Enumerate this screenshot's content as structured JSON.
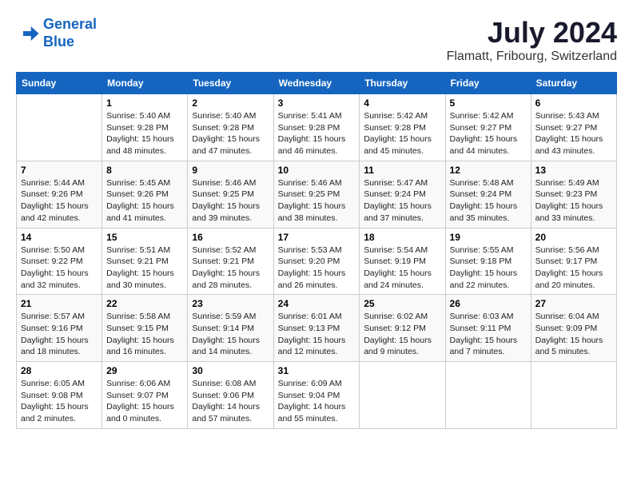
{
  "logo": {
    "line1": "General",
    "line2": "Blue"
  },
  "title": "July 2024",
  "location": "Flamatt, Fribourg, Switzerland",
  "days_of_week": [
    "Sunday",
    "Monday",
    "Tuesday",
    "Wednesday",
    "Thursday",
    "Friday",
    "Saturday"
  ],
  "weeks": [
    [
      {
        "day": "",
        "sunrise": "",
        "sunset": "",
        "daylight": ""
      },
      {
        "day": "1",
        "sunrise": "Sunrise: 5:40 AM",
        "sunset": "Sunset: 9:28 PM",
        "daylight": "Daylight: 15 hours and 48 minutes."
      },
      {
        "day": "2",
        "sunrise": "Sunrise: 5:40 AM",
        "sunset": "Sunset: 9:28 PM",
        "daylight": "Daylight: 15 hours and 47 minutes."
      },
      {
        "day": "3",
        "sunrise": "Sunrise: 5:41 AM",
        "sunset": "Sunset: 9:28 PM",
        "daylight": "Daylight: 15 hours and 46 minutes."
      },
      {
        "day": "4",
        "sunrise": "Sunrise: 5:42 AM",
        "sunset": "Sunset: 9:28 PM",
        "daylight": "Daylight: 15 hours and 45 minutes."
      },
      {
        "day": "5",
        "sunrise": "Sunrise: 5:42 AM",
        "sunset": "Sunset: 9:27 PM",
        "daylight": "Daylight: 15 hours and 44 minutes."
      },
      {
        "day": "6",
        "sunrise": "Sunrise: 5:43 AM",
        "sunset": "Sunset: 9:27 PM",
        "daylight": "Daylight: 15 hours and 43 minutes."
      }
    ],
    [
      {
        "day": "7",
        "sunrise": "Sunrise: 5:44 AM",
        "sunset": "Sunset: 9:26 PM",
        "daylight": "Daylight: 15 hours and 42 minutes."
      },
      {
        "day": "8",
        "sunrise": "Sunrise: 5:45 AM",
        "sunset": "Sunset: 9:26 PM",
        "daylight": "Daylight: 15 hours and 41 minutes."
      },
      {
        "day": "9",
        "sunrise": "Sunrise: 5:46 AM",
        "sunset": "Sunset: 9:25 PM",
        "daylight": "Daylight: 15 hours and 39 minutes."
      },
      {
        "day": "10",
        "sunrise": "Sunrise: 5:46 AM",
        "sunset": "Sunset: 9:25 PM",
        "daylight": "Daylight: 15 hours and 38 minutes."
      },
      {
        "day": "11",
        "sunrise": "Sunrise: 5:47 AM",
        "sunset": "Sunset: 9:24 PM",
        "daylight": "Daylight: 15 hours and 37 minutes."
      },
      {
        "day": "12",
        "sunrise": "Sunrise: 5:48 AM",
        "sunset": "Sunset: 9:24 PM",
        "daylight": "Daylight: 15 hours and 35 minutes."
      },
      {
        "day": "13",
        "sunrise": "Sunrise: 5:49 AM",
        "sunset": "Sunset: 9:23 PM",
        "daylight": "Daylight: 15 hours and 33 minutes."
      }
    ],
    [
      {
        "day": "14",
        "sunrise": "Sunrise: 5:50 AM",
        "sunset": "Sunset: 9:22 PM",
        "daylight": "Daylight: 15 hours and 32 minutes."
      },
      {
        "day": "15",
        "sunrise": "Sunrise: 5:51 AM",
        "sunset": "Sunset: 9:21 PM",
        "daylight": "Daylight: 15 hours and 30 minutes."
      },
      {
        "day": "16",
        "sunrise": "Sunrise: 5:52 AM",
        "sunset": "Sunset: 9:21 PM",
        "daylight": "Daylight: 15 hours and 28 minutes."
      },
      {
        "day": "17",
        "sunrise": "Sunrise: 5:53 AM",
        "sunset": "Sunset: 9:20 PM",
        "daylight": "Daylight: 15 hours and 26 minutes."
      },
      {
        "day": "18",
        "sunrise": "Sunrise: 5:54 AM",
        "sunset": "Sunset: 9:19 PM",
        "daylight": "Daylight: 15 hours and 24 minutes."
      },
      {
        "day": "19",
        "sunrise": "Sunrise: 5:55 AM",
        "sunset": "Sunset: 9:18 PM",
        "daylight": "Daylight: 15 hours and 22 minutes."
      },
      {
        "day": "20",
        "sunrise": "Sunrise: 5:56 AM",
        "sunset": "Sunset: 9:17 PM",
        "daylight": "Daylight: 15 hours and 20 minutes."
      }
    ],
    [
      {
        "day": "21",
        "sunrise": "Sunrise: 5:57 AM",
        "sunset": "Sunset: 9:16 PM",
        "daylight": "Daylight: 15 hours and 18 minutes."
      },
      {
        "day": "22",
        "sunrise": "Sunrise: 5:58 AM",
        "sunset": "Sunset: 9:15 PM",
        "daylight": "Daylight: 15 hours and 16 minutes."
      },
      {
        "day": "23",
        "sunrise": "Sunrise: 5:59 AM",
        "sunset": "Sunset: 9:14 PM",
        "daylight": "Daylight: 15 hours and 14 minutes."
      },
      {
        "day": "24",
        "sunrise": "Sunrise: 6:01 AM",
        "sunset": "Sunset: 9:13 PM",
        "daylight": "Daylight: 15 hours and 12 minutes."
      },
      {
        "day": "25",
        "sunrise": "Sunrise: 6:02 AM",
        "sunset": "Sunset: 9:12 PM",
        "daylight": "Daylight: 15 hours and 9 minutes."
      },
      {
        "day": "26",
        "sunrise": "Sunrise: 6:03 AM",
        "sunset": "Sunset: 9:11 PM",
        "daylight": "Daylight: 15 hours and 7 minutes."
      },
      {
        "day": "27",
        "sunrise": "Sunrise: 6:04 AM",
        "sunset": "Sunset: 9:09 PM",
        "daylight": "Daylight: 15 hours and 5 minutes."
      }
    ],
    [
      {
        "day": "28",
        "sunrise": "Sunrise: 6:05 AM",
        "sunset": "Sunset: 9:08 PM",
        "daylight": "Daylight: 15 hours and 2 minutes."
      },
      {
        "day": "29",
        "sunrise": "Sunrise: 6:06 AM",
        "sunset": "Sunset: 9:07 PM",
        "daylight": "Daylight: 15 hours and 0 minutes."
      },
      {
        "day": "30",
        "sunrise": "Sunrise: 6:08 AM",
        "sunset": "Sunset: 9:06 PM",
        "daylight": "Daylight: 14 hours and 57 minutes."
      },
      {
        "day": "31",
        "sunrise": "Sunrise: 6:09 AM",
        "sunset": "Sunset: 9:04 PM",
        "daylight": "Daylight: 14 hours and 55 minutes."
      },
      {
        "day": "",
        "sunrise": "",
        "sunset": "",
        "daylight": ""
      },
      {
        "day": "",
        "sunrise": "",
        "sunset": "",
        "daylight": ""
      },
      {
        "day": "",
        "sunrise": "",
        "sunset": "",
        "daylight": ""
      }
    ]
  ]
}
